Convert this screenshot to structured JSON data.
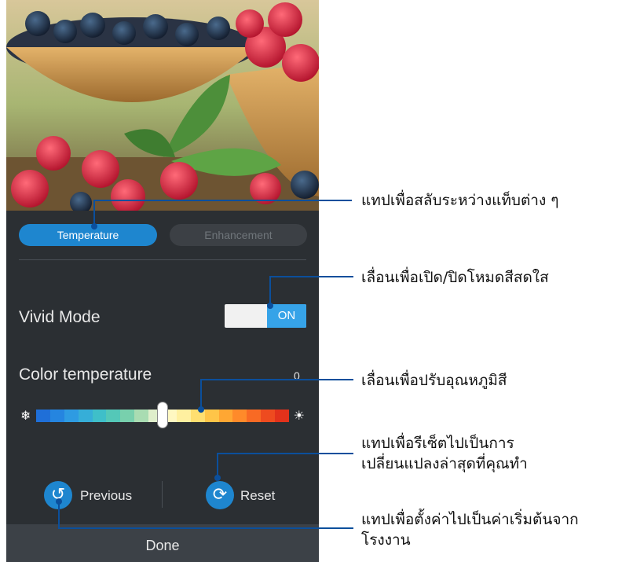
{
  "tabs": {
    "active": "Temperature",
    "inactive": "Enhancement"
  },
  "vivid": {
    "label": "Vivid Mode",
    "state": "ON"
  },
  "color_temp": {
    "label": "Color temperature",
    "value": "0",
    "level_fraction": 0.5
  },
  "buttons": {
    "previous": "Previous",
    "reset": "Reset",
    "done": "Done"
  },
  "annotations": {
    "tabs": "แทปเพื่อสลับระหว่างแท็บต่าง ๆ",
    "vivid": "เลื่อนเพื่อเปิด/ปิดโหมดสีสดใส",
    "temp": "เลื่อนเพื่อปรับอุณหภูมิสี",
    "reset_line1": "แทปเพื่อรีเซ็ตไปเป็นการ",
    "reset_line2": "เปลี่ยนแปลงล่าสุดที่คุณทำ",
    "previous_line1": "แทปเพื่อตั้งค่าไปเป็นค่าเริ่มต้นจาก",
    "previous_line2": "โรงงาน"
  },
  "colors": {
    "accent": "#1e86cf",
    "callout_line": "#0b4f9c",
    "background": "#2b2f33"
  },
  "icons": {
    "snow": "snowflake-icon",
    "sun": "sun-icon",
    "previous": "undo-icon",
    "reset": "refresh-icon"
  }
}
